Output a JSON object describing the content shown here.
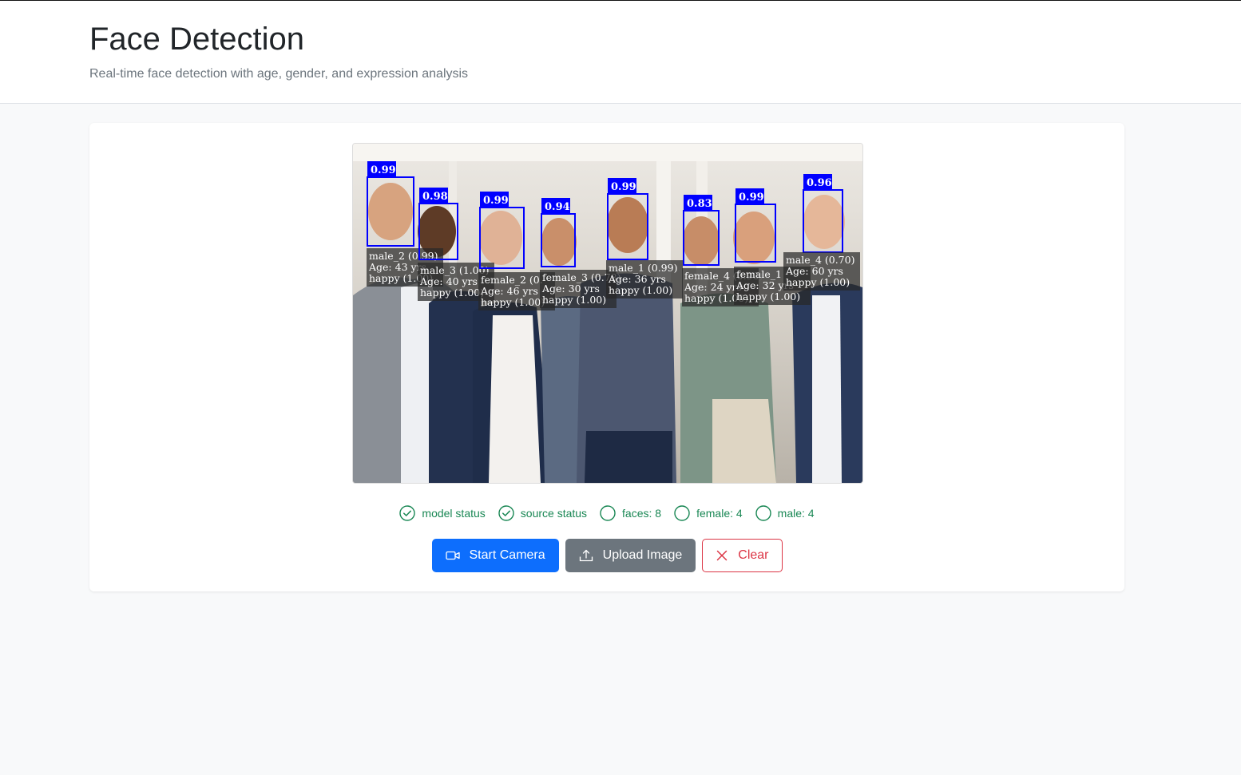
{
  "header": {
    "title": "Face Detection",
    "subtitle": "Real-time face detection with age, gender, and expression analysis"
  },
  "status": {
    "model": "model status",
    "source": "source status",
    "faces": "faces: 8",
    "female": "female: 4",
    "male": "male: 4"
  },
  "buttons": {
    "start_camera": "Start Camera",
    "upload_image": "Upload Image",
    "clear": "Clear"
  },
  "detections": [
    {
      "score": "0.99",
      "label": "male_2 (0.99)",
      "age": "Age: 43 yrs",
      "expression": "happy (1.00)"
    },
    {
      "score": "0.98",
      "label": "male_3 (1.00)",
      "age": "Age: 40 yrs",
      "expression": "happy (1.00)"
    },
    {
      "score": "0.99",
      "label": "female_2 (0.",
      "age": "Age: 46 yrs",
      "expression": "happy (1.00)"
    },
    {
      "score": "0.94",
      "label": "female_3 (0.78)",
      "age": "Age: 30 yrs",
      "expression": "happy (1.00)"
    },
    {
      "score": "0.99",
      "label": "male_1 (0.99)",
      "age": "Age: 36 yrs",
      "expression": "happy (1.00)"
    },
    {
      "score": "0.83",
      "label": "female_4 (0.90)",
      "age": "Age: 24 yrs",
      "expression": "happy (1.00)"
    },
    {
      "score": "0.99",
      "label": "female_1",
      "age": "Age: 32 yrs",
      "expression": "happy (1.00)"
    },
    {
      "score": "0.96",
      "label": "male_4 (0.70)",
      "age": "Age: 60 yrs",
      "expression": "happy (1.00)"
    }
  ],
  "colors": {
    "primary": "#0d6efd",
    "secondary": "#6c757d",
    "danger": "#dc3545",
    "success": "#198754",
    "detection_box": "#0000ff"
  }
}
